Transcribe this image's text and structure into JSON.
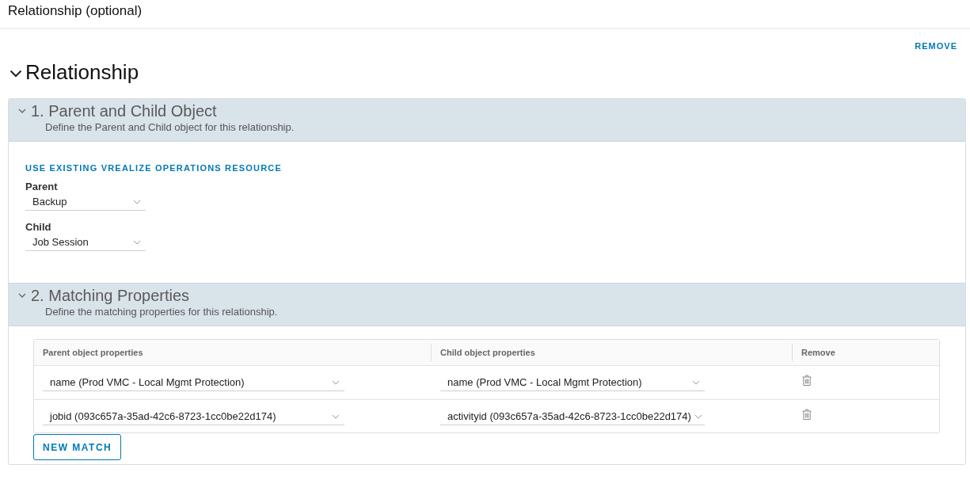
{
  "page": {
    "title": "Relationship (optional)",
    "remove_link": "REMOVE"
  },
  "relationship": {
    "title": "Relationship",
    "expanded": true,
    "steps": [
      {
        "kind": "objects",
        "title": "1. Parent and Child Object",
        "description": "Define the Parent and Child object for this relationship.",
        "expanded": true,
        "link": "USE EXISTING VREALIZE OPERATIONS RESOURCE",
        "fields": [
          {
            "label": "Parent",
            "value": "Backup"
          },
          {
            "label": "Child",
            "value": "Job Session"
          }
        ]
      },
      {
        "kind": "matching",
        "title": "2. Matching Properties",
        "description": "Define the matching properties for this relationship.",
        "expanded": true,
        "table": {
          "columns": [
            "Parent object properties",
            "Child object properties",
            "Remove"
          ],
          "rows": [
            {
              "parent": "name (Prod VMC - Local Mgmt Protection)",
              "child": "name (Prod VMC - Local Mgmt Protection)"
            },
            {
              "parent": "jobid (093c657a-35ad-42c6-8723-1cc0be22d174)",
              "child": "activityid (093c657a-35ad-42c6-8723-1cc0be22d174)"
            }
          ]
        },
        "button": "NEW MATCH"
      }
    ]
  }
}
